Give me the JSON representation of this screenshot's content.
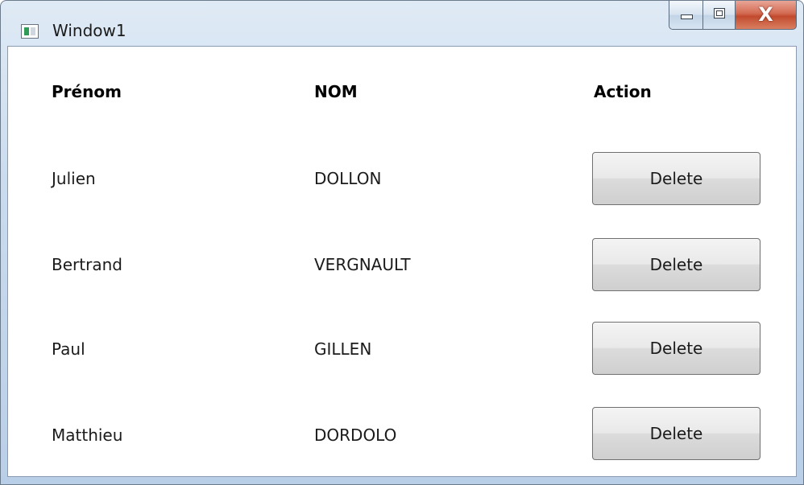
{
  "window": {
    "title": "Window1",
    "icon": "application-window-icon",
    "caption_buttons": {
      "minimize_icon": "minimize-icon",
      "maximize_icon": "maximize-icon",
      "close_label": "X"
    }
  },
  "table": {
    "headers": {
      "prenom": "Prénom",
      "nom": "NOM",
      "action": "Action"
    },
    "rows": [
      {
        "prenom": "Julien",
        "nom": "DOLLON",
        "action_label": "Delete"
      },
      {
        "prenom": "Bertrand",
        "nom": "VERGNAULT",
        "action_label": "Delete"
      },
      {
        "prenom": "Paul",
        "nom": "GILLEN",
        "action_label": "Delete"
      },
      {
        "prenom": "Matthieu",
        "nom": "DORDOLO",
        "action_label": "Delete"
      }
    ]
  },
  "colors": {
    "titlebar": "#c9dbee",
    "close_button": "#c24a2e",
    "content_background": "#ffffff"
  }
}
